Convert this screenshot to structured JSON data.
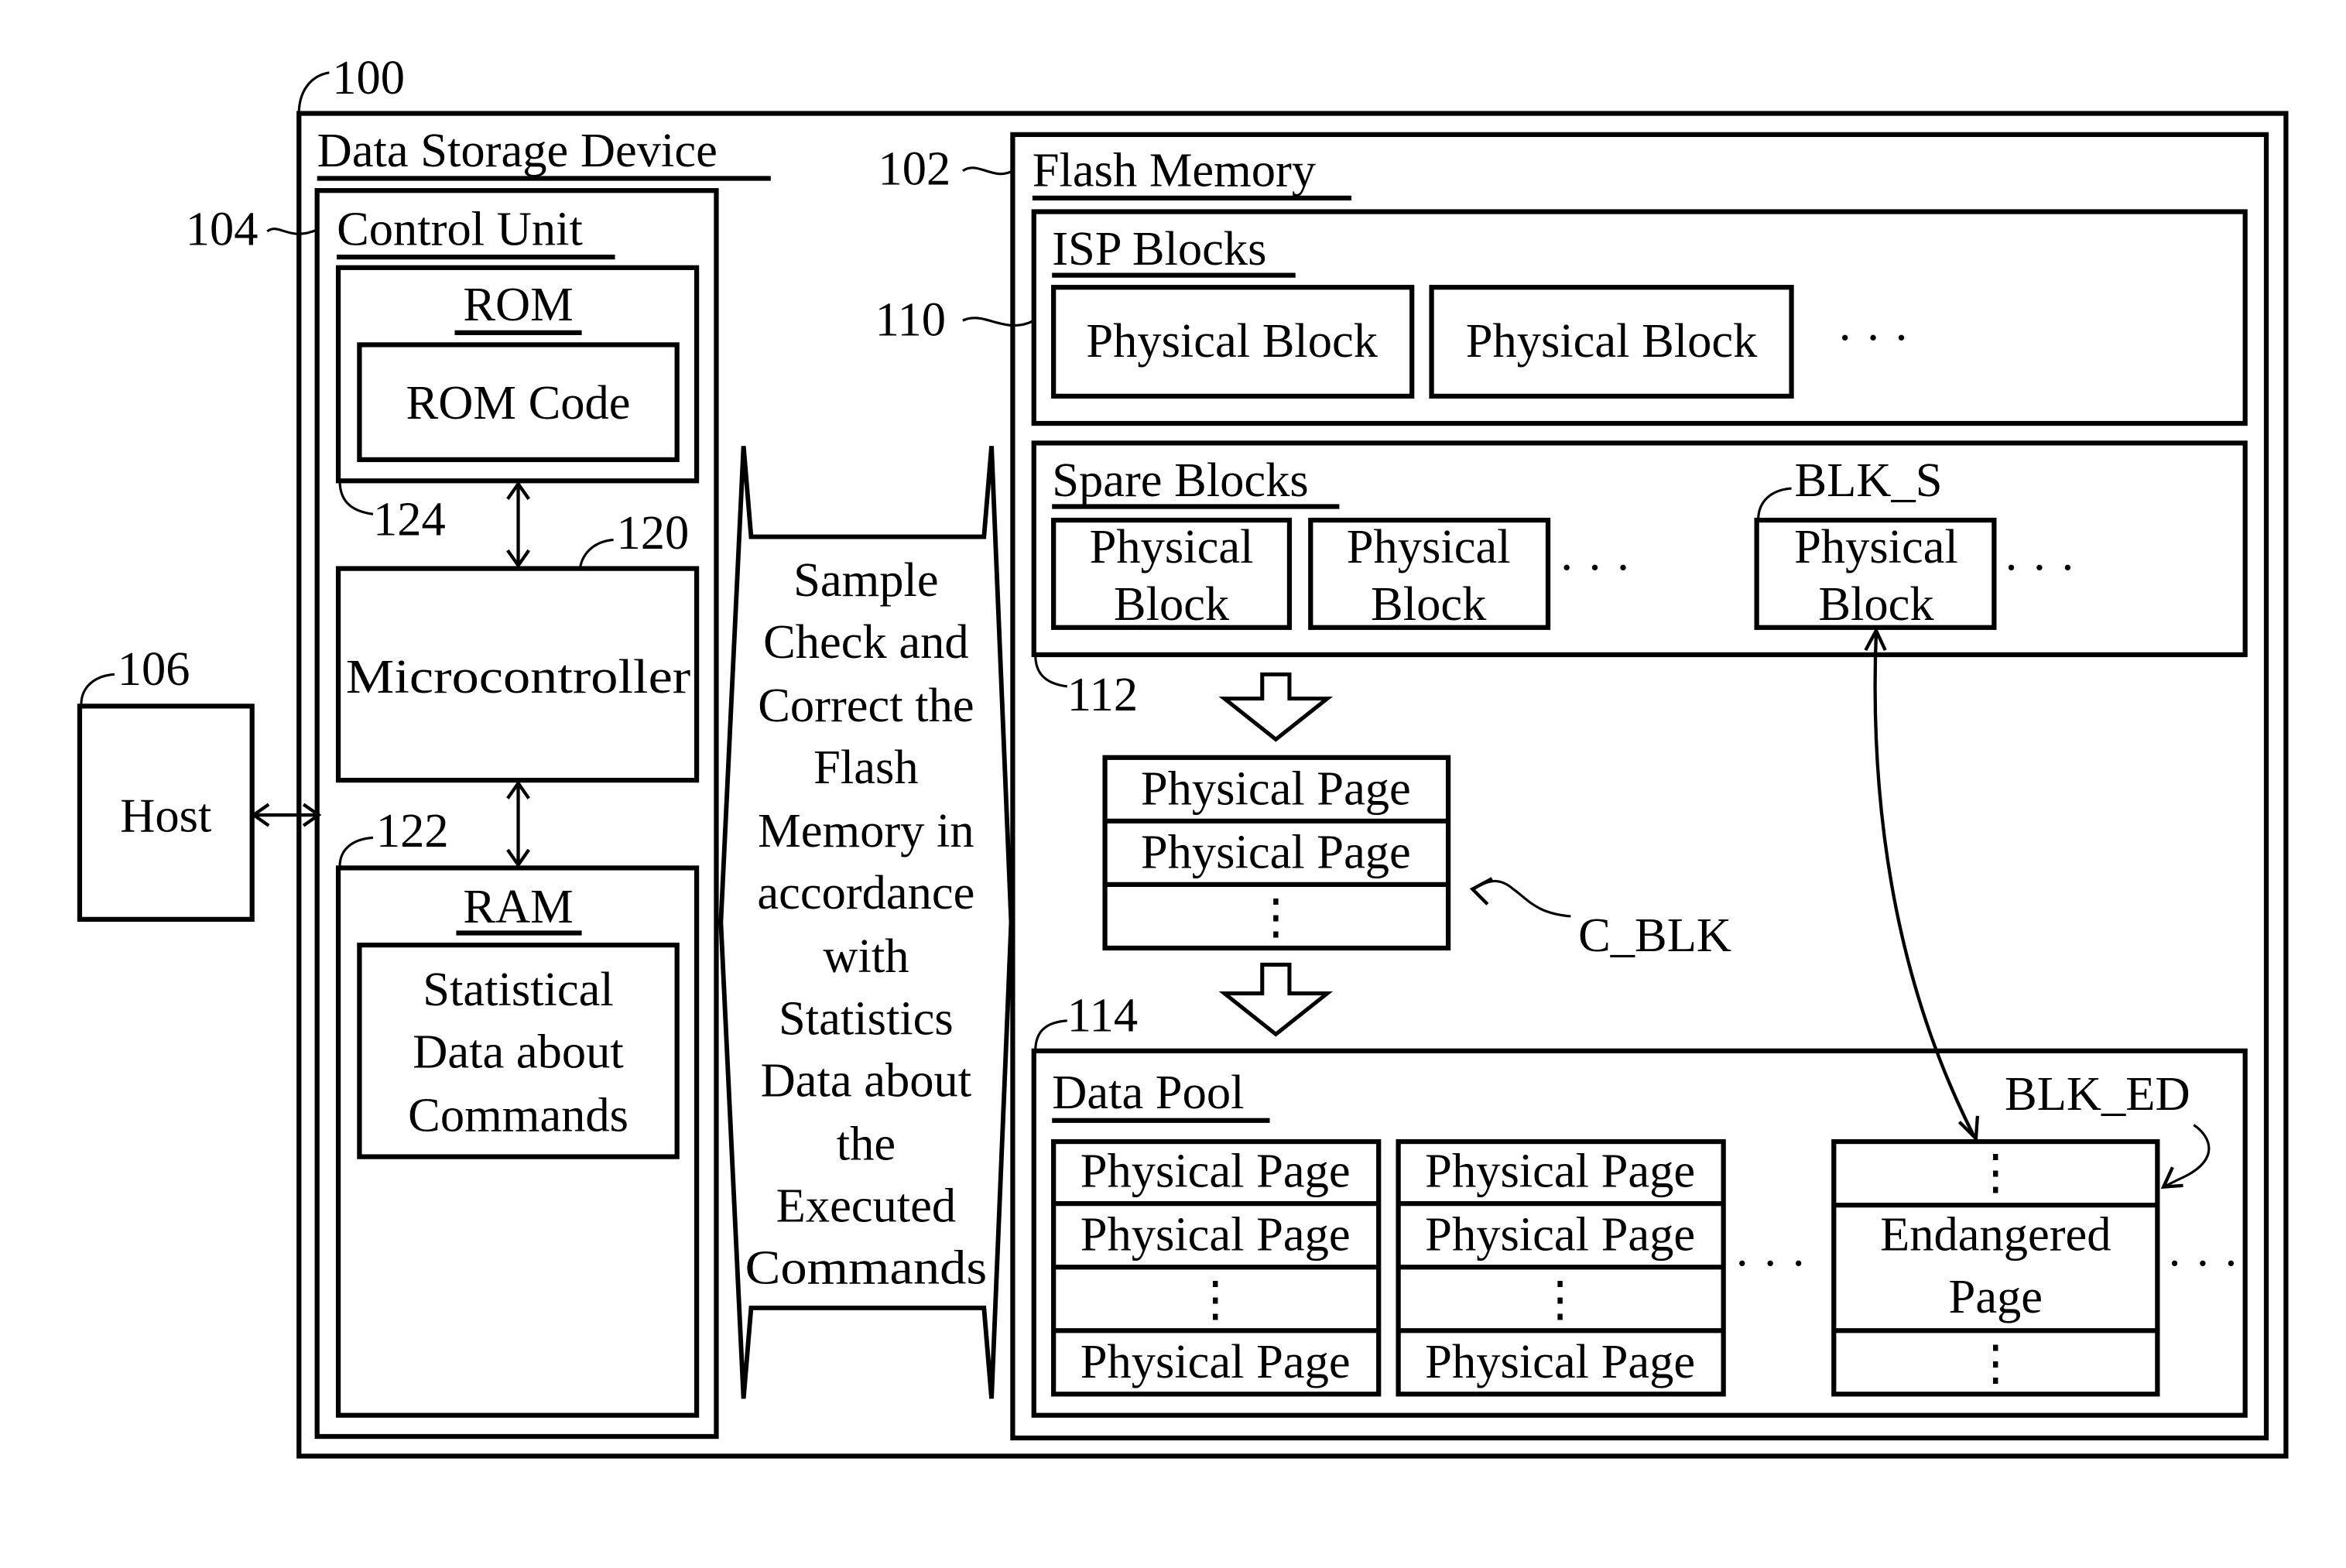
{
  "title": "Data Storage Device block diagram",
  "refs": {
    "device": "100",
    "flash": "102",
    "control_unit": "104",
    "host": "106",
    "isp_blocks": "110",
    "spare_blocks": "112",
    "data_pool": "114",
    "microcontroller": "120",
    "ram": "122",
    "rom": "124"
  },
  "labels": {
    "device": "Data Storage Device",
    "control_unit": "Control Unit",
    "rom": "ROM",
    "rom_code": "ROM Code",
    "microcontroller": "Microcontroller",
    "ram": "RAM",
    "stat_data": [
      "Statistical",
      "Data about",
      "Commands"
    ],
    "host": "Host",
    "middle_arrow": [
      "Sample",
      "Check and",
      "Correct the",
      "Flash",
      "Memory in",
      "accordance",
      "with",
      "Statistics",
      "Data about",
      "the",
      "Executed",
      "Commands"
    ],
    "flash": "Flash Memory",
    "isp_blocks": "ISP Blocks",
    "physical_block": "Physical Block",
    "physical": "Physical",
    "block": "Block",
    "spare_blocks": "Spare Blocks",
    "blk_s": "BLK_S",
    "physical_page": "Physical Page",
    "c_blk": "C_BLK",
    "data_pool": "Data Pool",
    "blk_ed": "BLK_ED",
    "endangered": "Endangered",
    "page": "Page",
    "ellipsis": "· · ·",
    "vdots": "⋮"
  }
}
